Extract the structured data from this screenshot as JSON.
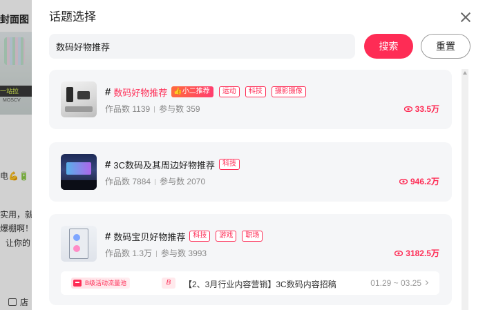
{
  "background": {
    "title": "封面图",
    "image_banner_text": "一站拉",
    "image_brand_text": "MOSCV",
    "line1": "电💪🔋",
    "line2": "实用，就",
    "line3": "爆棚啊！",
    "line4": "让你的",
    "shop_label": "店"
  },
  "modal": {
    "title": "话题选择",
    "search_value": "数码好物推荐",
    "search_label": "搜索",
    "reset_label": "重置"
  },
  "topics": [
    {
      "name": "数码好物推荐",
      "hot_badge": "小二推荐",
      "tags": [
        "运动",
        "科技",
        "摄影摄像"
      ],
      "works_label": "作品数",
      "works": "1139",
      "participants_label": "参与数",
      "participants": "359",
      "views": "33.5万"
    },
    {
      "name": "3C数码及其周边好物推荐",
      "tags": [
        "科技"
      ],
      "works_label": "作品数",
      "works": "7884",
      "participants_label": "参与数",
      "participants": "2070",
      "views": "946.2万"
    },
    {
      "name": "数码宝贝好物推荐",
      "tags": [
        "科技",
        "游戏",
        "职场"
      ],
      "works_label": "作品数",
      "works": "1.3万",
      "participants_label": "参与数",
      "participants": "3993",
      "views": "3182.5万",
      "promo": {
        "badge": "B级活动流量池",
        "letter": "B",
        "text": "【2、3月行业内容营销】3C数码内容招稿",
        "date": "01.29 ~ 03.25"
      }
    }
  ],
  "colors": {
    "accent": "#fe2c55",
    "card_bg": "#f5f6f8",
    "input_bg": "#f3f4f6"
  },
  "icons": [
    "close-icon",
    "eye-icon",
    "thumbs-up-icon",
    "chevron-right-icon",
    "store-icon",
    "scroll-up-arrow-icon"
  ]
}
